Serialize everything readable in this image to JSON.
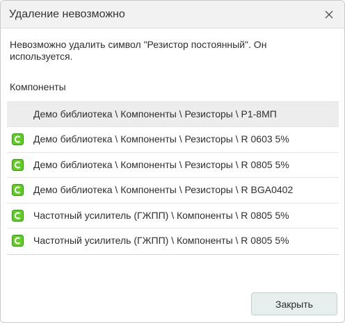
{
  "dialog": {
    "title": "Удаление невозможно",
    "close_icon": "close-icon",
    "message": "Невозможно удалить символ \"Резистор постоянный\". Он используется.",
    "section_label": "Компоненты",
    "list_header": "Демо библиотека \\ Компоненты \\ Резисторы \\ Р1-8МП",
    "items": [
      {
        "label": "Демо библиотека \\ Компоненты \\ Резисторы \\ R 0603 5%",
        "icon": "component-icon"
      },
      {
        "label": "Демо библиотека \\ Компоненты \\ Резисторы \\ R 0805 5%",
        "icon": "component-icon"
      },
      {
        "label": "Демо библиотека \\ Компоненты \\ Резисторы \\ R BGA0402",
        "icon": "component-icon"
      },
      {
        "label": "Частотный усилитель (ГЖПП) \\ Компоненты \\ R 0805 5%",
        "icon": "component-icon"
      },
      {
        "label": "Частотный усилитель (ГЖПП) \\ Компоненты \\ R 0805 5%",
        "icon": "component-icon"
      }
    ],
    "close_button_label": "Закрыть"
  },
  "colors": {
    "icon_green": "#5fcf1f",
    "icon_green_dark": "#2f9a0c",
    "titlebar_bg": "#f2f2f2",
    "button_bg": "#e6eeee"
  }
}
